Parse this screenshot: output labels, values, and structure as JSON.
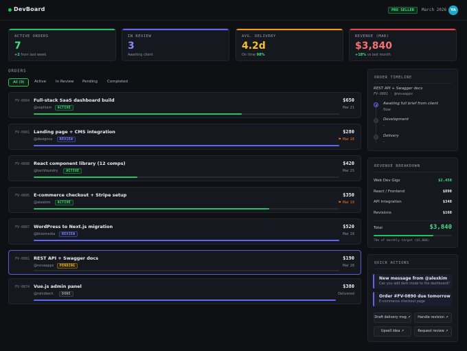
{
  "app": {
    "name": "DevBoard",
    "badge": "PRO SELLER",
    "date": "March 2026",
    "avatar": "YA"
  },
  "kpis": [
    {
      "label": "ACTIVE ORDERS",
      "value": "7",
      "sub_accent": "+2",
      "sub": " from last week",
      "color": "#22c55e"
    },
    {
      "label": "IN REVIEW",
      "value": "3",
      "sub_accent": "",
      "sub": "Awaiting client",
      "color": "#6366f1"
    },
    {
      "label": "AVG. DELIVERY",
      "value": "4.2d",
      "sub_accent": "",
      "sub": "On time ",
      "sub_tail": "98%",
      "color": "#f59e0b"
    },
    {
      "label": "REVENUE (MAR)",
      "value": "$3,840",
      "sub_accent": "+18%",
      "sub": " vs last month",
      "color": "#ef4444"
    }
  ],
  "orders_title": "ORDERS",
  "tabs": [
    "All (9)",
    "Active",
    "In Review",
    "Pending",
    "Completed"
  ],
  "orders": [
    {
      "id": "FV-0904",
      "title": "Full-stack SaaS dashboard build",
      "client": "@sophlam",
      "status": "ACTIVE",
      "price": "$650",
      "due": "Mar 21",
      "late": false,
      "progress": 0.68
    },
    {
      "id": "FV-0901",
      "title": "Landing page + CMS integration",
      "client": "@designco",
      "status": "REVIEW",
      "price": "$280",
      "due": "Mar 18",
      "late": true,
      "progress": 1.0
    },
    {
      "id": "FV-0898",
      "title": "React component library (12 comps)",
      "client": "@techfoundry",
      "status": "ACTIVE",
      "price": "$420",
      "due": "Mar 25",
      "late": false,
      "progress": 0.34
    },
    {
      "id": "FV-0895",
      "title": "E-commerce checkout + Stripe setup",
      "client": "@alexkim",
      "status": "ACTIVE",
      "price": "$350",
      "due": "Mar 19",
      "late": true,
      "progress": 0.77
    },
    {
      "id": "FV-0887",
      "title": "WordPress to Next.js migration",
      "client": "@bloomedia",
      "status": "REVIEW",
      "price": "$520",
      "due": "Mar 18",
      "late": false,
      "progress": 1.0
    },
    {
      "id": "FV-0881",
      "title": "REST API + Swagger docs",
      "client": "@novaapps",
      "status": "PENDING",
      "price": "$190",
      "due": "Mar 28",
      "late": false,
      "progress": 0
    },
    {
      "id": "FV-0874",
      "title": "Vue.js admin panel",
      "client": "@rohidtech",
      "status": "DONE",
      "price": "$380",
      "due": "Delivered",
      "late": false,
      "progress": 1.0
    }
  ],
  "timeline": {
    "title": "ORDER TIMELINE",
    "order_title": "REST API + Swagger docs",
    "order_sub": "FV-0881 · @novaapps",
    "steps": [
      {
        "label": "Awaiting full brief from client",
        "note": "Now",
        "current": true
      },
      {
        "label": "Development",
        "note": "–",
        "current": false
      },
      {
        "label": "Delivery",
        "note": "–",
        "current": false
      }
    ]
  },
  "revenue": {
    "title": "REVENUE BREAKDOWN",
    "rows": [
      {
        "label": "Web Dev Gigs",
        "value": "$2,450",
        "accent": true
      },
      {
        "label": "React / Frontend",
        "value": "$890",
        "accent": false
      },
      {
        "label": "API Integration",
        "value": "$340",
        "accent": false
      },
      {
        "label": "Revisions",
        "value": "$160",
        "accent": false
      }
    ],
    "total_label": "Total",
    "total_value": "$3,840",
    "target_progress": 0.76,
    "note": "76% of monthly target ($5,000)"
  },
  "quick": {
    "title": "QUICK ACTIONS",
    "messages": [
      {
        "title": "New message from @alexkim",
        "sub": "Can you add dark mode to the dashboard?"
      },
      {
        "title": "Order #FV-0890 due tomorrow",
        "sub": "E-commerce checkout page"
      }
    ],
    "buttons": [
      "Draft delivery msg ↗",
      "Handle revision ↗",
      "Upsell idea ↗",
      "Request review ↗"
    ]
  }
}
